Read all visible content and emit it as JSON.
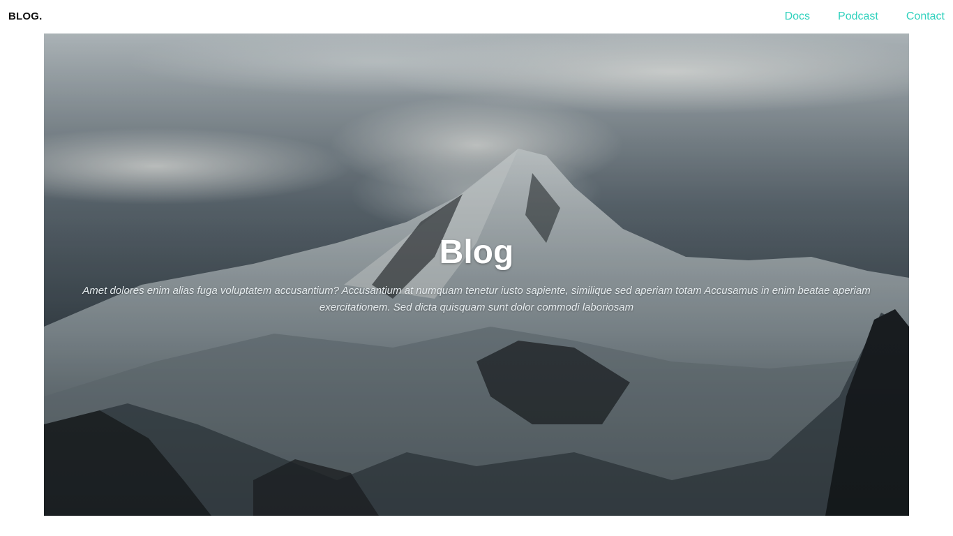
{
  "header": {
    "brand": "BLOG.",
    "nav": [
      {
        "label": "Docs"
      },
      {
        "label": "Podcast"
      },
      {
        "label": "Contact"
      }
    ]
  },
  "hero": {
    "image": "snowy-mountain-peak-clouds",
    "title": "Blog",
    "subtitle": "Amet dolores enim alias fuga voluptatem accusantium? Accusantium at numquam tenetur iusto sapiente, similique sed aperiam totam Accusamus in enim beatae aperiam exercitationem. Sed dicta quisquam sunt dolor commodi laboriosam"
  },
  "colors": {
    "accent": "#2fd1bd",
    "brand": "#111111"
  }
}
